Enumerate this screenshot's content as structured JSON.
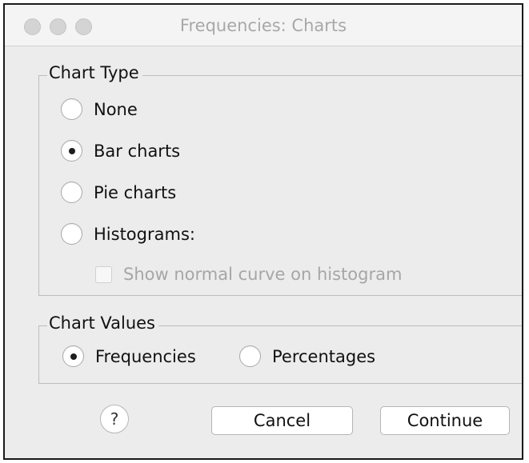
{
  "window": {
    "title": "Frequencies: Charts"
  },
  "chart_type": {
    "legend": "Chart Type",
    "options": [
      {
        "label": "None",
        "selected": false
      },
      {
        "label": "Bar charts",
        "selected": true
      },
      {
        "label": "Pie charts",
        "selected": false
      },
      {
        "label": "Histograms:",
        "selected": false
      }
    ],
    "normal_curve": {
      "label": "Show normal curve on histogram",
      "checked": false,
      "enabled": false
    }
  },
  "chart_values": {
    "legend": "Chart Values",
    "options": [
      {
        "label": "Frequencies",
        "selected": true
      },
      {
        "label": "Percentages",
        "selected": false
      }
    ]
  },
  "buttons": {
    "help": "?",
    "cancel": "Cancel",
    "continue": "Continue"
  }
}
